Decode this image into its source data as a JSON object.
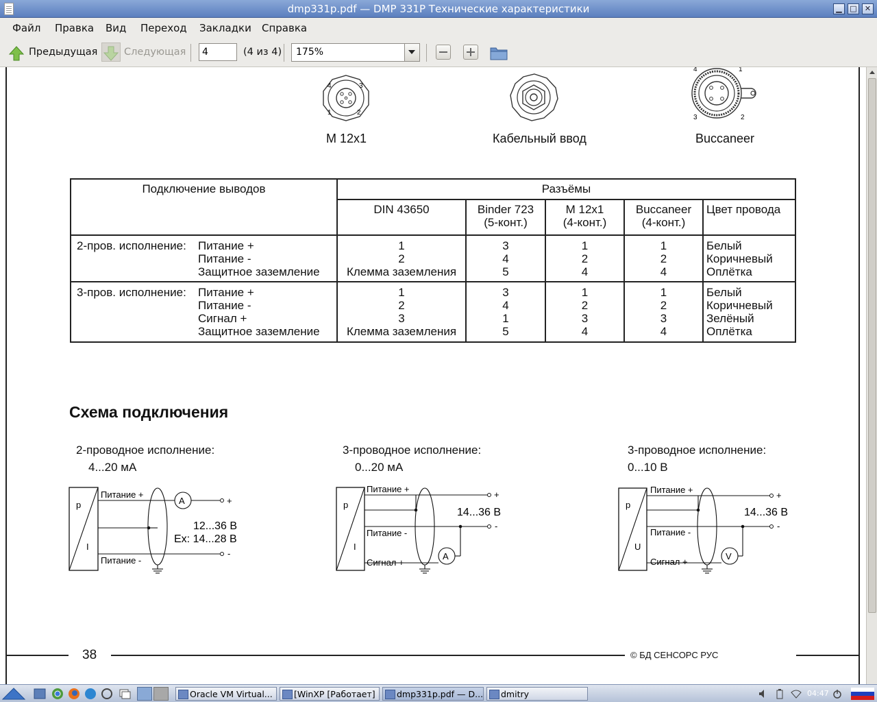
{
  "window": {
    "title": "dmp331p.pdf — DMP 331P Технические характеристики",
    "minimize": "▁",
    "maximize": "□",
    "close": "✕"
  },
  "menu": [
    "Файл",
    "Правка",
    "Вид",
    "Переход",
    "Закладки",
    "Справка"
  ],
  "toolbar": {
    "prev_label": "Предыдущая",
    "next_label": "Следующая",
    "page_value": "4",
    "page_of": "(4 из 4)",
    "zoom_value": "175%",
    "icons": [
      "up-arrow-icon",
      "down-arrow-icon",
      "zoom-out-icon",
      "zoom-in-icon",
      "folder-icon"
    ]
  },
  "connectors": {
    "m12": "M 12x1",
    "cable": "Кабельный ввод",
    "buccaneer": "Buccaneer",
    "m12_pins": [
      "4",
      "3",
      "1",
      "2"
    ],
    "buccaneer_pins": [
      "4",
      "1",
      "3",
      "2"
    ]
  },
  "table": {
    "h_connection": "Подключение выводов",
    "h_connectors": "Разъёмы",
    "cols": [
      "DIN 43650",
      "Binder 723\n(5-конт.)",
      "M 12x1\n(4-конт.)",
      "Buccaneer\n(4-конт.)",
      "Цвет провода"
    ],
    "groups": [
      {
        "label": "2-пров. исполнение:",
        "rows": [
          [
            "Питание +",
            "1",
            "3",
            "1",
            "1",
            "Белый"
          ],
          [
            "Питание -",
            "2",
            "4",
            "2",
            "2",
            "Коричневый"
          ],
          [
            "Защитное заземление",
            "Клемма заземления",
            "5",
            "4",
            "4",
            "Оплётка"
          ]
        ]
      },
      {
        "label": "3-пров. исполнение:",
        "rows": [
          [
            "Питание +",
            "1",
            "3",
            "1",
            "1",
            "Белый"
          ],
          [
            "Питание -",
            "2",
            "4",
            "2",
            "2",
            "Коричневый"
          ],
          [
            "Сигнал +",
            "3",
            "1",
            "3",
            "3",
            "Зелёный"
          ],
          [
            "Защитное заземление",
            "Клемма заземления",
            "5",
            "4",
            "4",
            "Оплётка"
          ]
        ]
      }
    ]
  },
  "scheme": {
    "heading": "Схема подключения",
    "d1": {
      "title": "2-проводное исполнение:",
      "range": "4...20 мА",
      "power_plus": "Питание +",
      "power_minus": "Питание -",
      "p": "p",
      "i": "I",
      "meter": "A",
      "plus": "+",
      "minus": "-",
      "v1": "12...36 В",
      "v2": "Ex: 14...28 В"
    },
    "d2": {
      "title": "3-проводное исполнение:",
      "range": "0...20 мА",
      "power_plus": "Питание +",
      "power_minus": "Питание -",
      "signal_plus": "Сигнал +",
      "p": "p",
      "i": "I",
      "meter": "A",
      "plus": "+",
      "minus": "-",
      "v": "14...36 В"
    },
    "d3": {
      "title": "3-проводное исполнение:",
      "range": "0...10 В",
      "power_plus": "Питание +",
      "power_minus": "Питание -",
      "signal_plus": "Сигнал +",
      "p": "p",
      "u": "U",
      "meter": "V",
      "plus": "+",
      "minus": "-",
      "v": "14...36 В"
    }
  },
  "footer": {
    "page_number": "38",
    "copyright": "© БД СЕНСОРС РУС"
  },
  "taskbar": {
    "tasks": [
      "Oracle VM Virtual...",
      "[WinXP [Работает] ...",
      "dmp331p.pdf — D...",
      "dmitry"
    ],
    "clock": "04:47"
  }
}
